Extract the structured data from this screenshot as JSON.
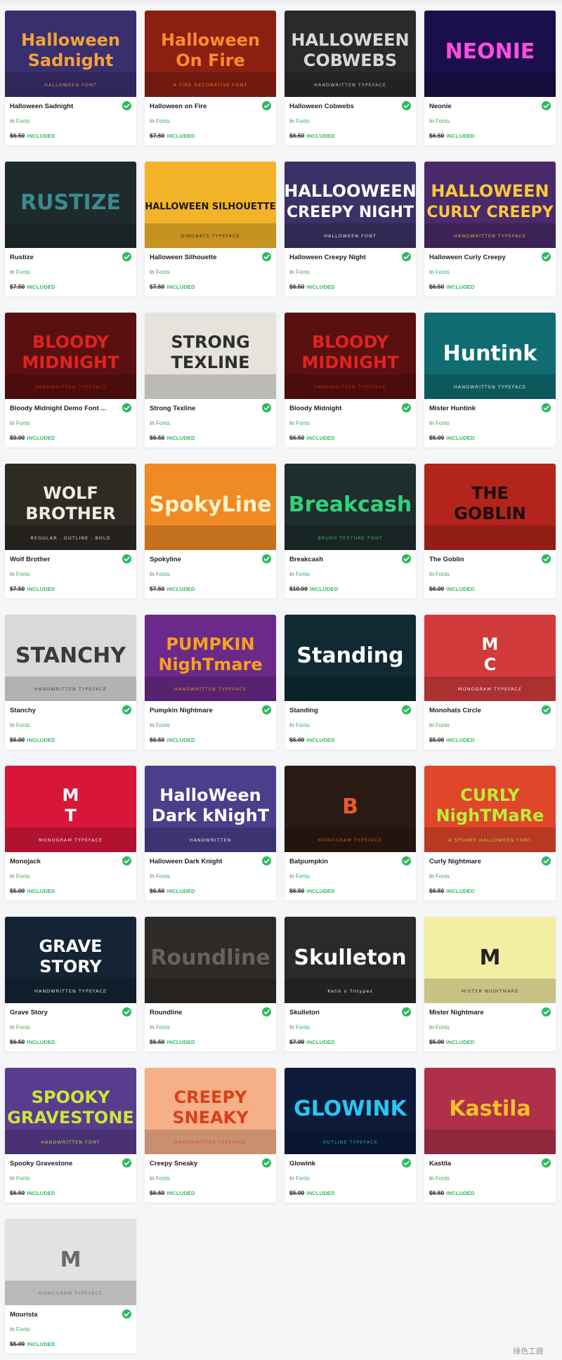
{
  "products": [
    {
      "title": "Halloween Sadnight",
      "category_prefix": "In",
      "category": "Fonts",
      "old_price": "$6.50",
      "badge": "INCLUDED",
      "thumb_text": [
        "Halloween",
        "Sadnight"
      ],
      "thumb_sub": "HALLOWEEN FONT",
      "colors": {
        "bg": "#3a2f6e",
        "fg": "#f3a23a"
      }
    },
    {
      "title": "Halloween on Fire",
      "category_prefix": "In",
      "category": "Fonts",
      "old_price": "$7.50",
      "badge": "INCLUDED",
      "thumb_text": [
        "Halloween",
        "On Fire"
      ],
      "thumb_sub": "A FIRE DECORATIVE FONT",
      "colors": {
        "bg": "#8a1f12",
        "fg": "#ff8a2a"
      }
    },
    {
      "title": "Halloween Cobwebs",
      "category_prefix": "In",
      "category": "Fonts",
      "old_price": "$6.50",
      "badge": "INCLUDED",
      "thumb_text": [
        "HALLOWEEN",
        "COBWEBS"
      ],
      "thumb_sub": "HANDWRITTEN TYPEFACE",
      "colors": {
        "bg": "#2a2a2a",
        "fg": "#d8d8d8"
      }
    },
    {
      "title": "Neonie",
      "category_prefix": "In",
      "category": "Fonts",
      "old_price": "$6.50",
      "badge": "INCLUDED",
      "thumb_text": [
        "NEONIE"
      ],
      "thumb_sub": "",
      "colors": {
        "bg": "#1a0f4a",
        "fg": "#ff4de1"
      }
    },
    {
      "title": "Rustize",
      "category_prefix": "In",
      "category": "Fonts",
      "old_price": "$7.50",
      "badge": "INCLUDED",
      "thumb_text": [
        "RUSTIZE"
      ],
      "thumb_sub": "",
      "colors": {
        "bg": "#1f2a2c",
        "fg": "#3a8a92"
      }
    },
    {
      "title": "Halloween Silhouette",
      "category_prefix": "In",
      "category": "Fonts",
      "old_price": "$7.50",
      "badge": "INCLUDED",
      "thumb_text": [
        "HALLOWEEN SILHOUETTE"
      ],
      "thumb_sub": "DINGBATS TYPEFACE",
      "colors": {
        "bg": "#f2b328",
        "fg": "#1a1a1a"
      }
    },
    {
      "title": "Halloween Creepy Night",
      "category_prefix": "In",
      "category": "Fonts",
      "old_price": "$6.50",
      "badge": "INCLUDED",
      "thumb_text": [
        "HALLOOWEEN",
        "CREEPY NIGHT"
      ],
      "thumb_sub": "HALLOWEEN FONT",
      "colors": {
        "bg": "#3b3166",
        "fg": "#ffffff"
      }
    },
    {
      "title": "Halloween Curly Creepy",
      "category_prefix": "In",
      "category": "Fonts",
      "old_price": "$6.50",
      "badge": "INCLUDED",
      "thumb_text": [
        "HALLOWEEN",
        "CURLY CREEPY"
      ],
      "thumb_sub": "HANDWRITTEN TYPEFACE",
      "colors": {
        "bg": "#4a2a6a",
        "fg": "#f7c93a"
      }
    },
    {
      "title": "Bloody Midnight Demo Font ...",
      "category_prefix": "In",
      "category": "Fonts",
      "old_price": "$0.00",
      "badge": "INCLUDED",
      "thumb_text": [
        "BLOODY",
        "MIDNIGHT"
      ],
      "thumb_sub": "HANDWRITTEN TYPEFACE",
      "colors": {
        "bg": "#5a1010",
        "fg": "#e0231e"
      }
    },
    {
      "title": "Strong Texline",
      "category_prefix": "In",
      "category": "Fonts",
      "old_price": "$6.50",
      "badge": "INCLUDED",
      "thumb_text": [
        "STRONG",
        "TEXLINE"
      ],
      "thumb_sub": "",
      "colors": {
        "bg": "#e6e3dc",
        "fg": "#2e2e2e"
      }
    },
    {
      "title": "Bloody Midnight",
      "category_prefix": "In",
      "category": "Fonts",
      "old_price": "$6.50",
      "badge": "INCLUDED",
      "thumb_text": [
        "BLOODY",
        "MIDNIGHT"
      ],
      "thumb_sub": "HANDWRITTEN TYPEFACE",
      "colors": {
        "bg": "#5a1010",
        "fg": "#e0231e"
      }
    },
    {
      "title": "Mister Huntink",
      "category_prefix": "In",
      "category": "Fonts",
      "old_price": "$5.00",
      "badge": "INCLUDED",
      "thumb_text": [
        "Huntink"
      ],
      "thumb_sub": "HANDWRITTEN TYPEFACE",
      "colors": {
        "bg": "#0f6d72",
        "fg": "#ffffff"
      }
    },
    {
      "title": "Wolf Brother",
      "category_prefix": "In",
      "category": "Fonts",
      "old_price": "$7.50",
      "badge": "INCLUDED",
      "thumb_text": [
        "WOLF",
        "BROTHER"
      ],
      "thumb_sub": "REGULAR . OUTLINE . BOLD",
      "colors": {
        "bg": "#2e2a24",
        "fg": "#f0ece4"
      }
    },
    {
      "title": "Spokyline",
      "category_prefix": "In",
      "category": "Fonts",
      "old_price": "$7.50",
      "badge": "INCLUDED",
      "thumb_text": [
        "SpokyLine"
      ],
      "thumb_sub": "",
      "colors": {
        "bg": "#f08a24",
        "fg": "#fff2c8"
      }
    },
    {
      "title": "Breakcash",
      "category_prefix": "In",
      "category": "Fonts",
      "old_price": "$10.00",
      "badge": "INCLUDED",
      "thumb_text": [
        "Breakcash"
      ],
      "thumb_sub": "BRUSH TEXTURE FONT",
      "colors": {
        "bg": "#1f2d2d",
        "fg": "#31d27a"
      }
    },
    {
      "title": "The Goblin",
      "category_prefix": "In",
      "category": "Fonts",
      "old_price": "$6.00",
      "badge": "INCLUDED",
      "thumb_text": [
        "THE",
        "GOBLIN"
      ],
      "thumb_sub": "",
      "colors": {
        "bg": "#b3251c",
        "fg": "#1a0a08"
      }
    },
    {
      "title": "Stanchy",
      "category_prefix": "In",
      "category": "Fonts",
      "old_price": "$6.00",
      "badge": "INCLUDED",
      "thumb_text": [
        "STANCHY"
      ],
      "thumb_sub": "HANDWRITTEN TYPEFACE",
      "colors": {
        "bg": "#d9d9d9",
        "fg": "#3a3a3a"
      }
    },
    {
      "title": "Pumpkin Nightmare",
      "category_prefix": "In",
      "category": "Fonts",
      "old_price": "$6.50",
      "badge": "INCLUDED",
      "thumb_text": [
        "PUMPKIN",
        "NighTmare"
      ],
      "thumb_sub": "HANDWRITTEN TYPEFACE",
      "colors": {
        "bg": "#6b2a8a",
        "fg": "#f6a21a"
      }
    },
    {
      "title": "Standing",
      "category_prefix": "In",
      "category": "Fonts",
      "old_price": "$6.00",
      "badge": "INCLUDED",
      "thumb_text": [
        "Standing"
      ],
      "thumb_sub": "",
      "colors": {
        "bg": "#0f2a33",
        "fg": "#ffffff"
      }
    },
    {
      "title": "Monohats Circle",
      "category_prefix": "In",
      "category": "Fonts",
      "old_price": "$5.00",
      "badge": "INCLUDED",
      "thumb_text": [
        "M",
        "C"
      ],
      "thumb_sub": "MONOGRAM TYPEFACE",
      "colors": {
        "bg": "#d13b3b",
        "fg": "#ffffff"
      }
    },
    {
      "title": "Monojack",
      "category_prefix": "In",
      "category": "Fonts",
      "old_price": "$5.00",
      "badge": "INCLUDED",
      "thumb_text": [
        "M",
        "T"
      ],
      "thumb_sub": "MONOGRAM TYPEFACE",
      "colors": {
        "bg": "#d8163a",
        "fg": "#ffffff"
      }
    },
    {
      "title": "Halloween Dark Knight",
      "category_prefix": "In",
      "category": "Fonts",
      "old_price": "$6.50",
      "badge": "INCLUDED",
      "thumb_text": [
        "HalloWeen",
        "Dark kNighT"
      ],
      "thumb_sub": "HANDWRITTEN",
      "colors": {
        "bg": "#4a3f8a",
        "fg": "#ffffff"
      }
    },
    {
      "title": "Batpumpkin",
      "category_prefix": "In",
      "category": "Fonts",
      "old_price": "$6.50",
      "badge": "INCLUDED",
      "thumb_text": [
        "B"
      ],
      "thumb_sub": "MONOGRAM TYPEFACE",
      "colors": {
        "bg": "#2a1a14",
        "fg": "#f05a28"
      }
    },
    {
      "title": "Curly Nightmare",
      "category_prefix": "In",
      "category": "Fonts",
      "old_price": "$6.50",
      "badge": "INCLUDED",
      "thumb_text": [
        "CURLY",
        "NighTMaRe"
      ],
      "thumb_sub": "A SPOOKY HALLOWEEN FONT",
      "colors": {
        "bg": "#e0462a",
        "fg": "#b8f03a"
      }
    },
    {
      "title": "Grave Story",
      "category_prefix": "In",
      "category": "Fonts",
      "old_price": "$6.50",
      "badge": "INCLUDED",
      "thumb_text": [
        "GRAVE",
        "STORY"
      ],
      "thumb_sub": "HANDWRITTEN TYPEFACE",
      "colors": {
        "bg": "#152434",
        "fg": "#ffffff"
      }
    },
    {
      "title": "Roundline",
      "category_prefix": "In",
      "category": "Fonts",
      "old_price": "$6.50",
      "badge": "INCLUDED",
      "thumb_text": [
        "Roundline"
      ],
      "thumb_sub": "",
      "colors": {
        "bg": "#2e2a28",
        "fg": "#6a6258"
      }
    },
    {
      "title": "Skulleton",
      "category_prefix": "In",
      "category": "Fonts",
      "old_price": "$7.00",
      "badge": "INCLUDED",
      "thumb_text": [
        "Skulleton"
      ],
      "thumb_sub": "Kelik x 7ntypes",
      "colors": {
        "bg": "#2a2a2a",
        "fg": "#ffffff"
      }
    },
    {
      "title": "Mister Nightmare",
      "category_prefix": "In",
      "category": "Fonts",
      "old_price": "$5.00",
      "badge": "INCLUDED",
      "thumb_text": [
        "M"
      ],
      "thumb_sub": "MISTER NIGHTMARE",
      "colors": {
        "bg": "#f4eea2",
        "fg": "#222222"
      }
    },
    {
      "title": "Spooky Gravestone",
      "category_prefix": "In",
      "category": "Fonts",
      "old_price": "$6.50",
      "badge": "INCLUDED",
      "thumb_text": [
        "SPOOKY",
        "GRAVESTONE"
      ],
      "thumb_sub": "HANDWRITTEN FONT",
      "colors": {
        "bg": "#5a3c8e",
        "fg": "#c9e83a"
      }
    },
    {
      "title": "Creepy Sneaky",
      "category_prefix": "In",
      "category": "Fonts",
      "old_price": "$6.50",
      "badge": "INCLUDED",
      "thumb_text": [
        "CREEPY",
        "SNEAKY"
      ],
      "thumb_sub": "HANDWRITTEN TYPEFACE",
      "colors": {
        "bg": "#f6b088",
        "fg": "#d8401e"
      }
    },
    {
      "title": "Glowink",
      "category_prefix": "In",
      "category": "Fonts",
      "old_price": "$5.00",
      "badge": "INCLUDED",
      "thumb_text": [
        "GLOWINK"
      ],
      "thumb_sub": "OUTLINE TYPEFACE",
      "colors": {
        "bg": "#0d1a3a",
        "fg": "#28c6f0"
      }
    },
    {
      "title": "Kastila",
      "category_prefix": "In",
      "category": "Fonts",
      "old_price": "$6.50",
      "badge": "INCLUDED",
      "thumb_text": [
        "Kastila"
      ],
      "thumb_sub": "",
      "colors": {
        "bg": "#b0304a",
        "fg": "#f7c02a"
      }
    },
    {
      "title": "Mourista",
      "category_prefix": "In",
      "category": "Fonts",
      "old_price": "$5.00",
      "badge": "INCLUDED",
      "thumb_text": [
        "M"
      ],
      "thumb_sub": "MONOGRAM TYPEFACE",
      "colors": {
        "bg": "#e2e2e2",
        "fg": "#6a6a6a"
      }
    }
  ],
  "watermark": "綠色工廠"
}
